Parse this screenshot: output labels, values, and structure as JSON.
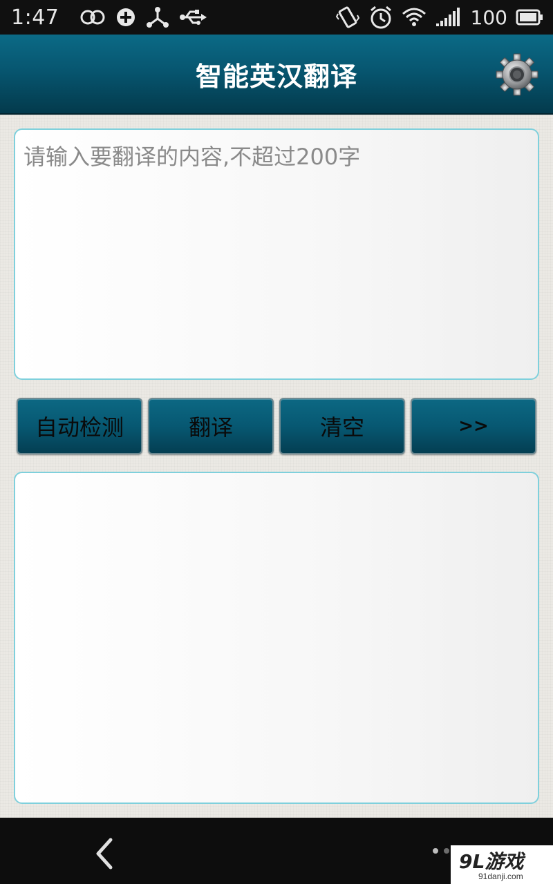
{
  "status_bar": {
    "time": "1:47",
    "battery_level": "100",
    "left_icons": [
      "link-rings-icon",
      "sync-icon",
      "share-node-icon",
      "usb-icon"
    ],
    "right_icons": [
      "vibrate-icon",
      "alarm-icon",
      "wifi-icon",
      "signal-icon",
      "battery-icon"
    ]
  },
  "header": {
    "title": "智能英汉翻译",
    "settings_icon": "gear-icon"
  },
  "input": {
    "placeholder": "请输入要翻译的内容,不超过200字",
    "value": ""
  },
  "buttons": {
    "auto_detect": "自动检测",
    "translate": "翻译",
    "clear": "清空",
    "more": ">>"
  },
  "output": {
    "text": ""
  },
  "nav_bar": {
    "back_icon": "back-chevron-icon"
  },
  "watermark": {
    "logo": "9L游戏",
    "site": "91danji.com"
  },
  "colors": {
    "header_teal": "#075670",
    "textbox_border": "#7fd0dc",
    "background": "#ebe9e4"
  }
}
